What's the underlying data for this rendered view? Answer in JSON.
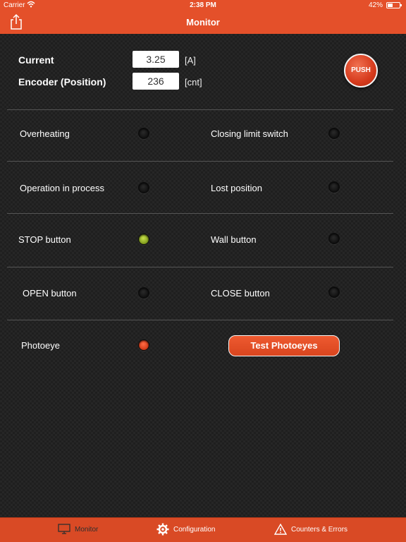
{
  "status_bar": {
    "carrier": "Carrier",
    "time": "2:38 PM",
    "battery": "42%"
  },
  "nav": {
    "title": "Monitor"
  },
  "readings": {
    "current_label": "Current",
    "current_value": "3.25",
    "current_unit": "[A]",
    "encoder_label": "Encoder (Position)",
    "encoder_value": "236",
    "encoder_unit": "[cnt]"
  },
  "push_button": "PUSH",
  "indicators": {
    "overheating": "Overheating",
    "closing_limit": "Closing limit switch",
    "operation": "Operation in process",
    "lost_position": "Lost position",
    "stop_button": "STOP button",
    "wall_button": "Wall button",
    "open_button": "OPEN button",
    "close_button": "CLOSE button",
    "photoeye": "Photoeye"
  },
  "led_states": {
    "overheating": "off",
    "closing_limit": "off",
    "operation": "off",
    "lost_position": "off",
    "stop_button": "green",
    "wall_button": "off",
    "open_button": "off",
    "close_button": "off",
    "photoeye": "red"
  },
  "test_photoeyes": "Test Photoeyes",
  "tabs": {
    "monitor": "Monitor",
    "configuration": "Configuration",
    "counters": "Counters & Errors"
  },
  "colors": {
    "accent": "#e4502a",
    "tab_bar": "#d94a25",
    "led_green": "#a8c232",
    "led_red": "#e84a25"
  },
  "icons": [
    "share-icon",
    "wifi-icon",
    "battery-icon",
    "monitor-icon",
    "gear-icon",
    "warning-icon"
  ]
}
